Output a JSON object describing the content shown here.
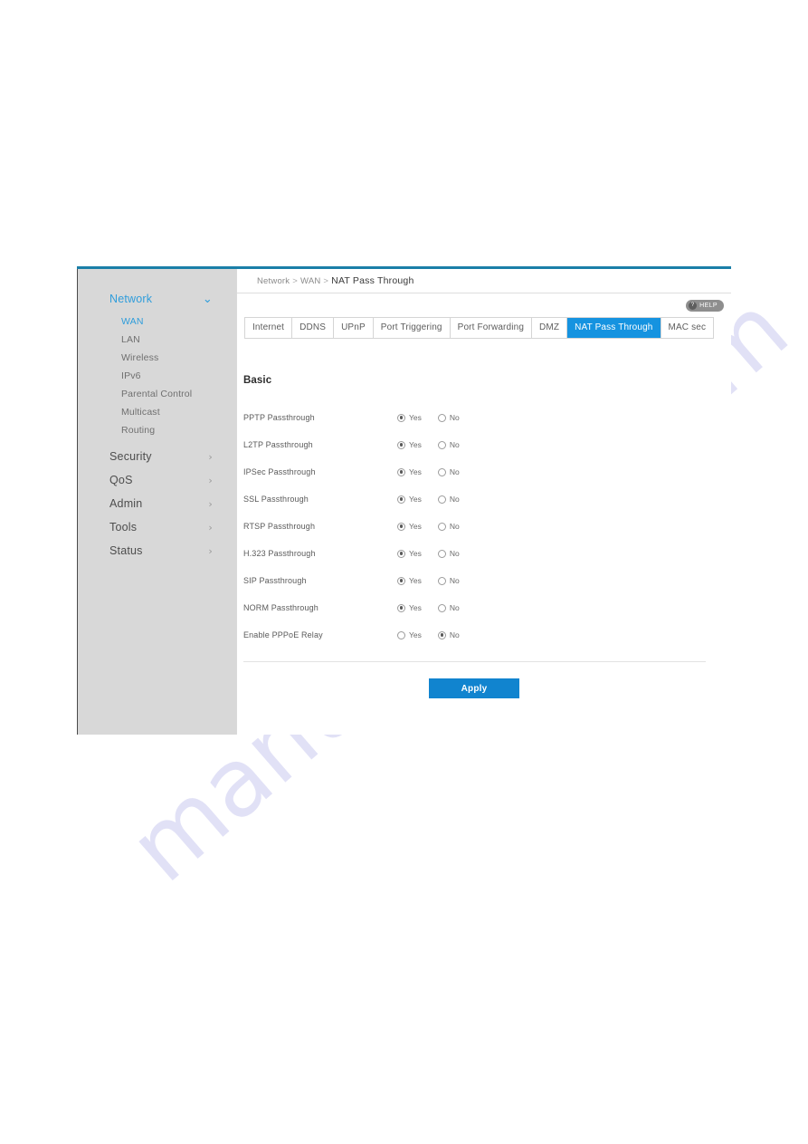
{
  "watermark": {
    "text": "manualshive.com"
  },
  "theme": {
    "accent": "#1593e0",
    "top_border": "#1a7fa8",
    "sidebar_bg": "#d8d8d8",
    "apply_bg": "#1184cf",
    "active_link": "#2f9ddb"
  },
  "breadcrumb": {
    "root": "Network",
    "sep1": ">",
    "mid": "WAN",
    "sep2": ">",
    "current": "NAT Pass Through"
  },
  "help": {
    "label": "HELP",
    "icon": "question-mark"
  },
  "sidebar": {
    "groups": [
      {
        "label": "Network",
        "active": true,
        "chevron": "⌄",
        "items": [
          {
            "label": "WAN",
            "active": true
          },
          {
            "label": "LAN",
            "active": false
          },
          {
            "label": "Wireless",
            "active": false
          },
          {
            "label": "IPv6",
            "active": false
          },
          {
            "label": "Parental Control",
            "active": false
          },
          {
            "label": "Multicast",
            "active": false
          },
          {
            "label": "Routing",
            "active": false
          }
        ]
      },
      {
        "label": "Security",
        "active": false,
        "chevron": "›",
        "items": []
      },
      {
        "label": "QoS",
        "active": false,
        "chevron": "›",
        "items": []
      },
      {
        "label": "Admin",
        "active": false,
        "chevron": "›",
        "items": []
      },
      {
        "label": "Tools",
        "active": false,
        "chevron": "›",
        "items": []
      },
      {
        "label": "Status",
        "active": false,
        "chevron": "›",
        "items": []
      }
    ]
  },
  "tabs": [
    {
      "label": "Internet",
      "active": false
    },
    {
      "label": "DDNS",
      "active": false
    },
    {
      "label": "UPnP",
      "active": false
    },
    {
      "label": "Port Triggering",
      "active": false
    },
    {
      "label": "Port Forwarding",
      "active": false
    },
    {
      "label": "DMZ",
      "active": false
    },
    {
      "label": "NAT Pass Through",
      "active": true
    },
    {
      "label": "MAC sec",
      "active": false
    }
  ],
  "main": {
    "section_title": "Basic",
    "option_yes": "Yes",
    "option_no": "No",
    "rows": [
      {
        "label": "PPTP Passthrough",
        "value": "Yes"
      },
      {
        "label": "L2TP Passthrough",
        "value": "Yes"
      },
      {
        "label": "IPSec Passthrough",
        "value": "Yes"
      },
      {
        "label": "SSL Passthrough",
        "value": "Yes"
      },
      {
        "label": "RTSP Passthrough",
        "value": "Yes"
      },
      {
        "label": "H.323 Passthrough",
        "value": "Yes"
      },
      {
        "label": "SIP Passthrough",
        "value": "Yes"
      },
      {
        "label": "NORM Passthrough",
        "value": "Yes"
      },
      {
        "label": "Enable PPPoE Relay",
        "value": "No"
      }
    ],
    "apply_label": "Apply"
  }
}
